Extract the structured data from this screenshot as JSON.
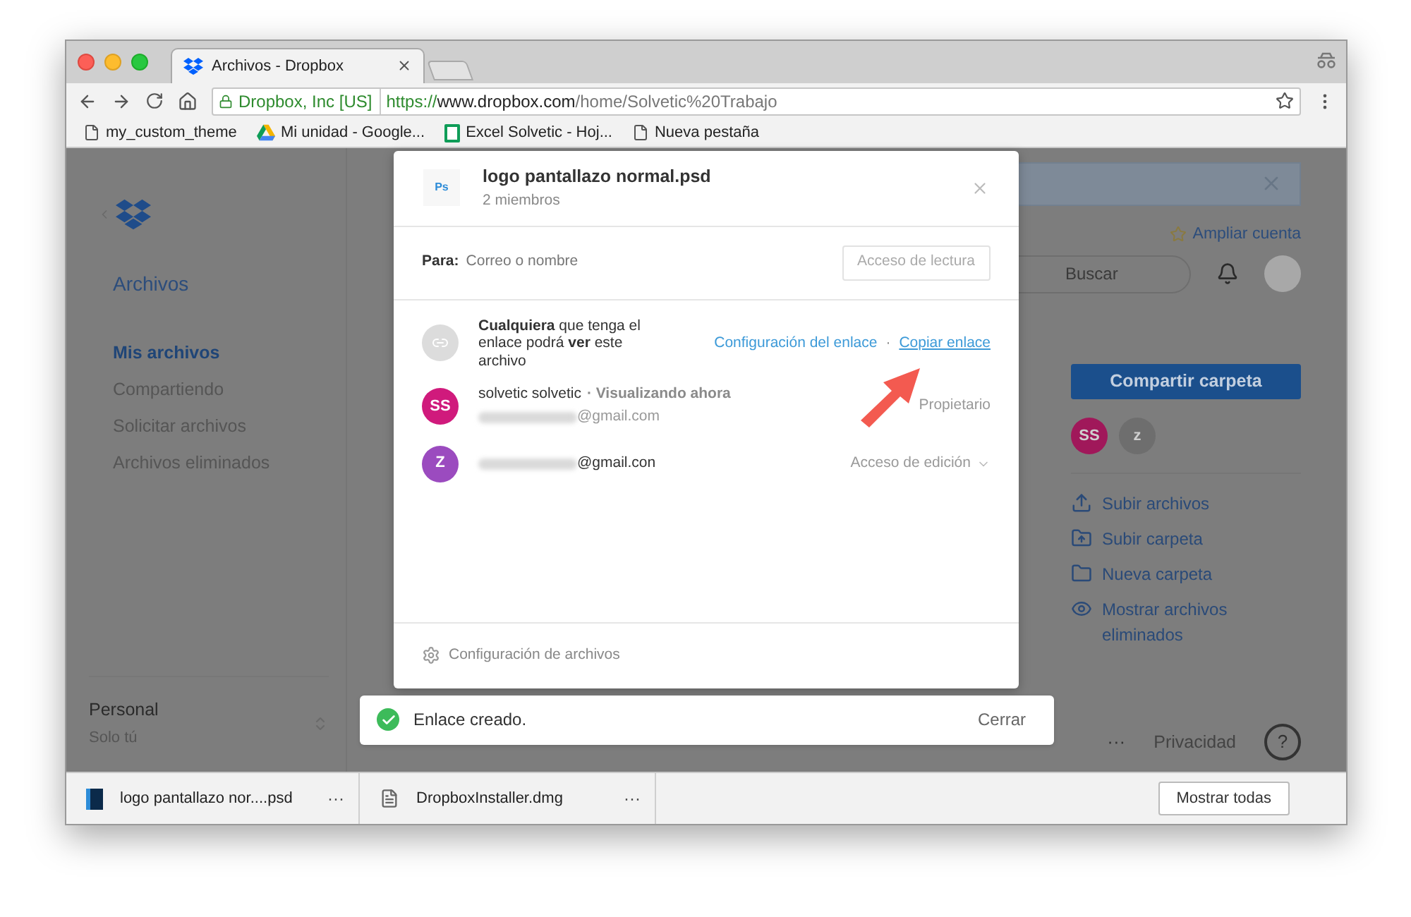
{
  "browser": {
    "tab_title": "Archivos - Dropbox",
    "address": {
      "owner": "Dropbox, Inc [US]",
      "scheme": "https://",
      "host": "www.dropbox.com",
      "path": "/home/Solvetic%20Trabajo"
    },
    "bookmarks": [
      {
        "label": "my_custom_theme",
        "kind": "page"
      },
      {
        "label": "Mi unidad - Google...",
        "kind": "drive"
      },
      {
        "label": "Excel Solvetic - Hoj...",
        "kind": "sheet"
      },
      {
        "label": "Nueva pestaña",
        "kind": "page"
      }
    ]
  },
  "sidebar": {
    "section_title": "Archivos",
    "items": [
      {
        "label": "Mis archivos",
        "selected": true
      },
      {
        "label": "Compartiendo",
        "selected": false
      },
      {
        "label": "Solicitar archivos",
        "selected": false
      },
      {
        "label": "Archivos eliminados",
        "selected": false
      }
    ],
    "account": {
      "name": "Personal",
      "subtitle": "Solo tú"
    }
  },
  "header": {
    "upgrade": "Ampliar cuenta",
    "search_placeholder": "Buscar"
  },
  "actions_panel": {
    "share_button": "Compartir carpeta",
    "members": [
      {
        "initials": "SS",
        "color": "#a0185a"
      },
      {
        "initials": "z",
        "color": "#6e6e6e"
      }
    ],
    "actions": [
      {
        "label": "Subir archivos",
        "kind": "upload_files"
      },
      {
        "label": "Subir carpeta",
        "kind": "upload_folder"
      },
      {
        "label": "Nueva carpeta",
        "kind": "new_folder"
      },
      {
        "label": "Mostrar archivos eliminados",
        "kind": "show_deleted"
      }
    ]
  },
  "footer": {
    "more": "···",
    "privacy": "Privacidad",
    "help": "?"
  },
  "dialog": {
    "file_badge": "Ps",
    "file_name": "logo pantallazo normal.psd",
    "subtitle": "2 miembros",
    "to_label": "Para:",
    "to_placeholder": "Correo o nombre",
    "access_button": "Acceso de lectura",
    "link": {
      "description": "**Cualquiera** que tenga el enlace podrá **ver** este archivo",
      "settings": "Configuración del enlace",
      "separator": "·",
      "copy": "Copiar enlace"
    },
    "members": [
      {
        "initials": "SS",
        "color": "#d01a7c",
        "name": "solvetic solvetic",
        "status": "· Visualizando ahora",
        "email": "@gmail.com",
        "role": "Propietario",
        "kind": "owner"
      },
      {
        "initials": "Z",
        "color": "#9b4bbf",
        "email": "@gmail.con",
        "role": "Acceso de edición",
        "kind": "dropdown"
      }
    ],
    "footer": "Configuración de archivos"
  },
  "toast": {
    "message": "Enlace creado.",
    "close": "Cerrar"
  },
  "downloads": {
    "items": [
      {
        "name": "logo pantallazo nor....psd",
        "more": "···",
        "kind": "psd"
      },
      {
        "name": "DropboxInstaller.dmg",
        "more": "···",
        "kind": "dmg"
      }
    ],
    "show_all": "Mostrar todas"
  }
}
